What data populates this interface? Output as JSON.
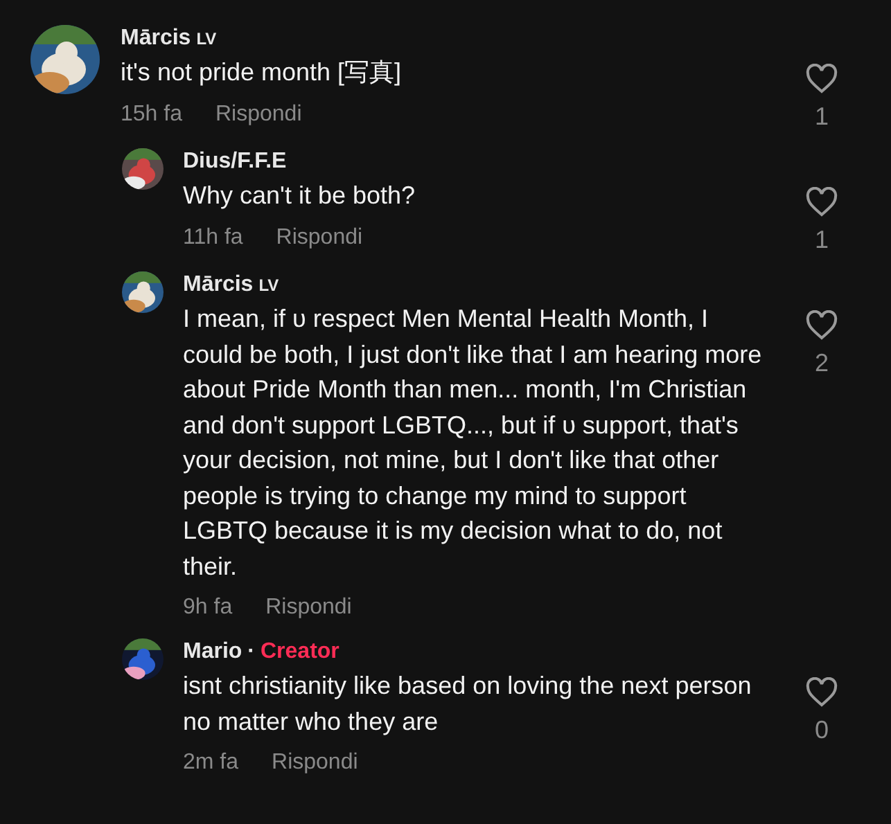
{
  "comments": [
    {
      "author": "Mārcis",
      "badge": "LV",
      "text": "it's not pride month [写真]",
      "time": "15h fa",
      "reply": "Rispondi",
      "likes": "1",
      "liked": false,
      "replies": [
        {
          "author": "Dius/F.F.E",
          "text": "Why can't it be both?",
          "time": "11h fa",
          "reply": "Rispondi",
          "likes": "1",
          "liked": false
        },
        {
          "author": "Mārcis",
          "badge": "LV",
          "text": "I mean, if ᴜ respect Men Mental Health Month, I could be both, I just don't like that I am hearing more about Pride Month than men... month, I'm Christian and don't support LGBTQ..., but if ᴜ support, that's your decision, not mine, but I don't like that other people is trying to change my mind to support LGBTQ because it is my decision what to do, not their.",
          "time": "9h fa",
          "reply": "Rispondi",
          "likes": "2",
          "liked": false
        },
        {
          "author": "Mario",
          "separator": "·",
          "role": "Creator",
          "text": "isnt christianity like based on loving the next person no matter who they are",
          "time": "2m fa",
          "reply": "Rispondi",
          "likes": "0",
          "liked": false
        }
      ]
    }
  ]
}
